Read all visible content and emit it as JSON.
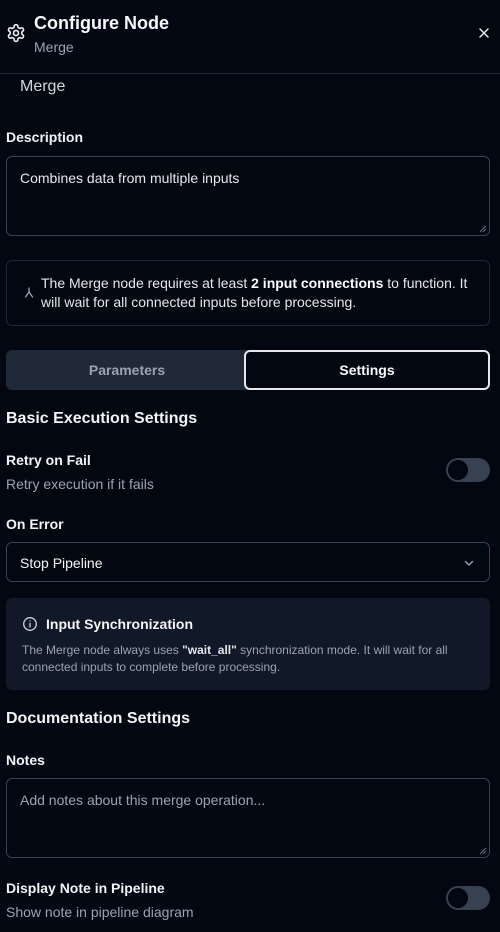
{
  "header": {
    "title": "Configure Node",
    "subtitle": "Merge",
    "icon": "gear-icon",
    "close_icon": "close-icon"
  },
  "name_field": {
    "value": "Merge"
  },
  "description": {
    "label": "Description",
    "value": "Combines data from multiple inputs"
  },
  "info_notice": {
    "text_before": "The Merge node requires at least ",
    "text_bold": "2 input connections",
    "text_after": " to function. It will wait for all connected inputs before processing.",
    "icon": "merge-icon"
  },
  "tabs": [
    {
      "label": "Parameters",
      "active": false
    },
    {
      "label": "Settings",
      "active": true
    }
  ],
  "basic_execution": {
    "title": "Basic Execution Settings",
    "retry_label": "Retry on Fail",
    "retry_desc": "Retry execution if it fails",
    "retry_enabled": false,
    "on_error_label": "On Error",
    "on_error_value": "Stop Pipeline"
  },
  "sync_notice": {
    "title": "Input Synchronization",
    "desc_before": "The Merge node always uses ",
    "desc_bold": "\"wait_all\"",
    "desc_after": " synchronization mode. It will wait for all connected inputs to complete before processing.",
    "icon": "info-icon"
  },
  "documentation": {
    "title": "Documentation Settings",
    "notes_label": "Notes",
    "notes_placeholder": "Add notes about this merge operation...",
    "notes_value": "",
    "display_label": "Display Note in Pipeline",
    "display_desc": "Show note in pipeline diagram",
    "display_enabled": false
  },
  "colors": {
    "background": "#030712",
    "border": "#374151",
    "muted_text": "#9ca3af",
    "card": "#111827"
  }
}
